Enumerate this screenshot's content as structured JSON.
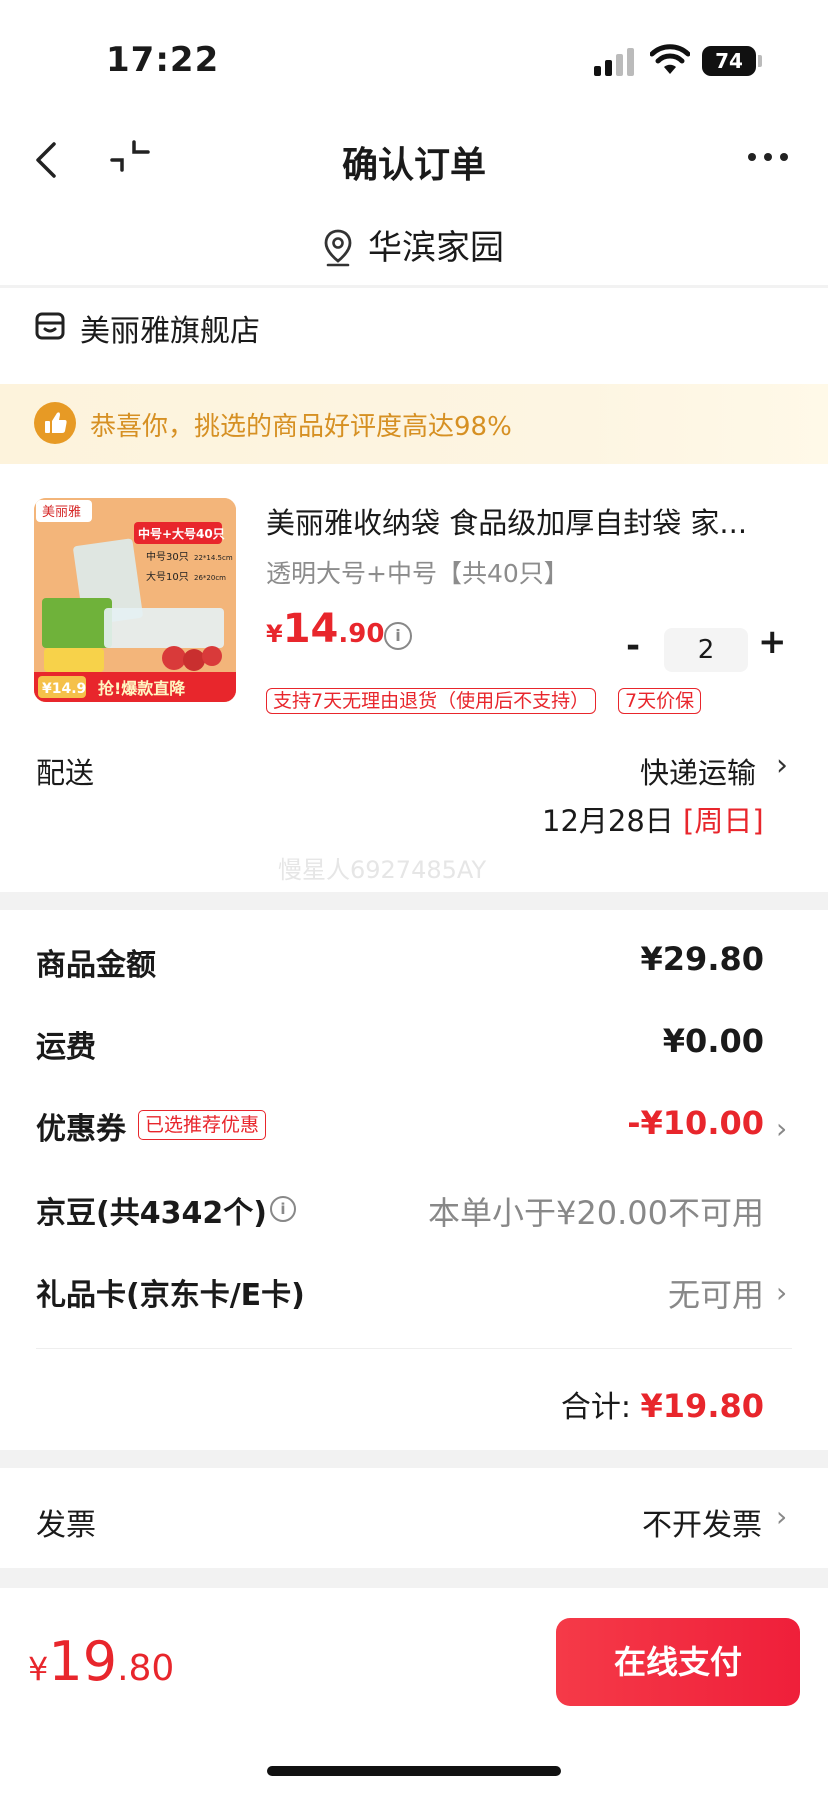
{
  "status_bar": {
    "time": "17:22",
    "battery": "74"
  },
  "header": {
    "title": "确认订单",
    "address": "华滨家园"
  },
  "store": {
    "name": "美丽雅旗舰店"
  },
  "banner": {
    "text": "恭喜你，挑选的商品好评度高达98%"
  },
  "product": {
    "name": "美丽雅收纳袋 食品级加厚自封袋 家...",
    "spec": "透明大号+中号【共40只】",
    "price_symbol": "¥",
    "price_int": "14",
    "price_dec": ".90",
    "quantity": "2",
    "minus": "-",
    "plus": "+",
    "tags": [
      "支持7天无理由退货（使用后不支持）",
      "7天价保"
    ],
    "image_texts": {
      "brand": "美丽雅",
      "headline": "中号+大号40只",
      "size1": "中号30只",
      "size2": "大号10只",
      "dim1": "22*14.5cm",
      "dim2": "26*20cm",
      "promo": "抢!爆款直降",
      "price_badge": "¥14.9"
    }
  },
  "delivery": {
    "label": "配送",
    "method": "快递运输",
    "date": "12月28日",
    "day": "[周日]"
  },
  "watermark": "慢星人6927485AY",
  "summary": {
    "goods_label": "商品金额",
    "goods_value": "¥29.80",
    "freight_label": "运费",
    "freight_value": "¥0.00",
    "coupon_label": "优惠券",
    "coupon_tag": "已选推荐优惠",
    "coupon_value": "-¥10.00",
    "beans_label": "京豆(共4342个)",
    "beans_value": "本单小于¥20.00不可用",
    "giftcard_label": "礼品卡(京东卡/E卡)",
    "giftcard_value": "无可用",
    "total_label": "合计:",
    "total_value": "¥19.80"
  },
  "invoice": {
    "label": "发票",
    "value": "不开发票"
  },
  "footer": {
    "symbol": "¥",
    "int": "19",
    "dec": ".80",
    "pay_button": "在线支付"
  },
  "icons": {
    "back": "back-arrow-icon",
    "shrink": "shrink-icon",
    "more": "more-dots-icon",
    "pin": "location-pin-icon",
    "store": "store-icon",
    "thumb": "thumbs-up-icon",
    "info": "info-icon",
    "chevron": "chevron-right-icon"
  },
  "colors": {
    "accent": "#e8262c",
    "banner_text": "#d69023",
    "banner_bg": "#fdf3dc"
  }
}
